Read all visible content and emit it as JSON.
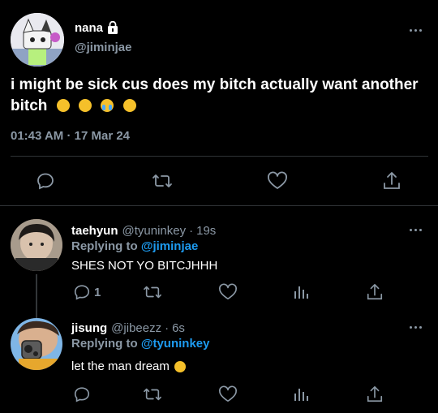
{
  "main_tweet": {
    "display_name": "nana",
    "handle": "@jiminjae",
    "text": "i might be sick cus does my bitch actually want another bitch",
    "emojis": [
      "pensive",
      "disappointed",
      "loudly-crying",
      "slightly-smiling"
    ],
    "timestamp": "01:43 AM · 17 Mar 24",
    "locked": true
  },
  "replies": [
    {
      "display_name": "taehyun",
      "handle": "@tyuninkey",
      "time": "19s",
      "replying_prefix": "Replying to",
      "replying_to": "@jiminjae",
      "text": "SHES NOT YO BITCJHHH",
      "reply_count": "1"
    },
    {
      "display_name": "jisung",
      "handle": "@jibeezz",
      "time": "6s",
      "replying_prefix": "Replying to",
      "replying_to": "@tyuninkey",
      "text": "let the man dream",
      "emojis": [
        "pensive"
      ]
    }
  ],
  "colors": {
    "background": "#000000",
    "text": "#e7e9ea",
    "muted": "#8b98a5",
    "link": "#1d9bf0",
    "divider": "#2f3336"
  }
}
